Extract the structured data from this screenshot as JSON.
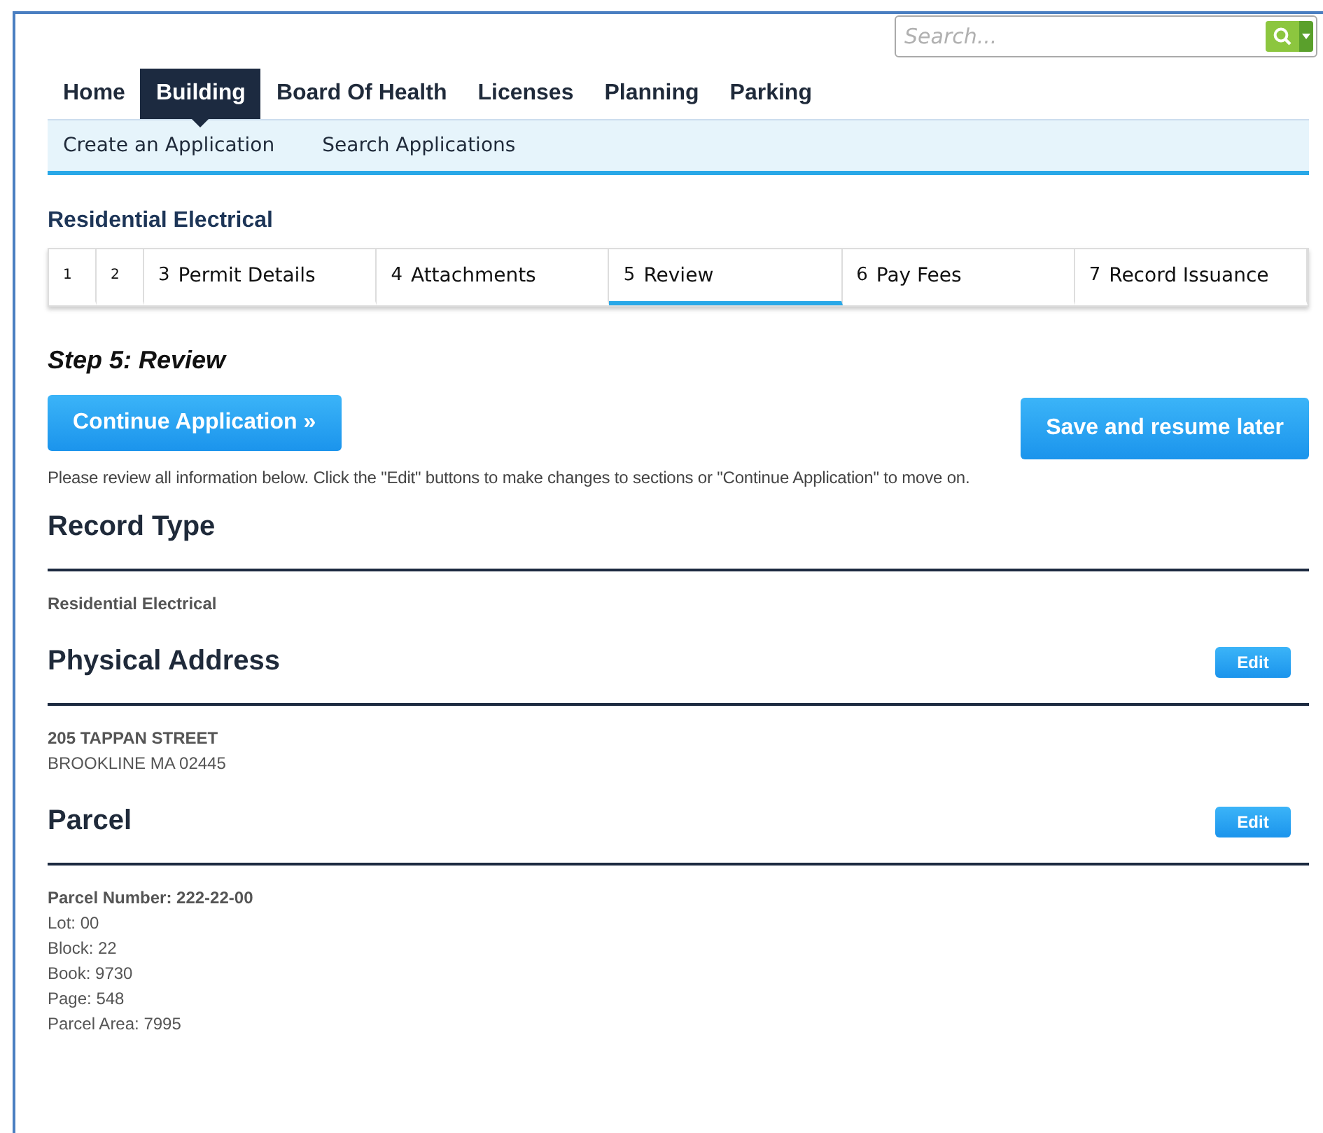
{
  "search": {
    "placeholder": "Search..."
  },
  "nav": [
    {
      "label": "Home",
      "selected": false
    },
    {
      "label": "Building",
      "selected": true
    },
    {
      "label": "Board Of Health",
      "selected": false
    },
    {
      "label": "Licenses",
      "selected": false
    },
    {
      "label": "Planning",
      "selected": false
    },
    {
      "label": "Parking",
      "selected": false
    }
  ],
  "subnav": [
    "Create an Application",
    "Search Applications"
  ],
  "record_title": "Residential Electrical",
  "steps": [
    {
      "number": "1",
      "selected": false
    },
    {
      "number": "2",
      "selected": false
    },
    {
      "number": "3",
      "label": "Permit Details",
      "selected": false
    },
    {
      "number": "4",
      "label": "Attachments",
      "selected": false
    },
    {
      "number": "5",
      "label": "Review",
      "selected": true
    },
    {
      "number": "6",
      "label": "Pay Fees",
      "selected": false
    },
    {
      "number": "7",
      "label": "Record Issuance",
      "selected": false
    }
  ],
  "step_heading": "Step 5: Review",
  "continue_button": "Continue Application »",
  "save_button": "Save and resume later",
  "instructions": "Please review all information below. Click the \"Edit\" buttons to make changes to sections or \"Continue Application\" to move on.",
  "sections": [
    {
      "title": "Record Type",
      "lines": [
        {
          "text": "Residential Electrical",
          "bold": true
        }
      ]
    },
    {
      "title": "Physical Address",
      "edit": "Edit",
      "lines": [
        {
          "text": "205 TAPPAN STREET",
          "bold": true
        },
        {
          "text": "BROOKLINE MA 02445",
          "bold": false
        }
      ]
    },
    {
      "title": "Parcel",
      "edit": "Edit",
      "lines": [
        {
          "text": "Parcel Number: 222-22-00",
          "bold": true
        },
        {
          "text": "Lot: 00",
          "bold": false
        },
        {
          "text": "Block: 22",
          "bold": false
        },
        {
          "text": "Book: 9730",
          "bold": false
        },
        {
          "text": "Page: 548",
          "bold": false
        },
        {
          "text": "Parcel Area: 7995",
          "bold": false
        }
      ]
    }
  ]
}
